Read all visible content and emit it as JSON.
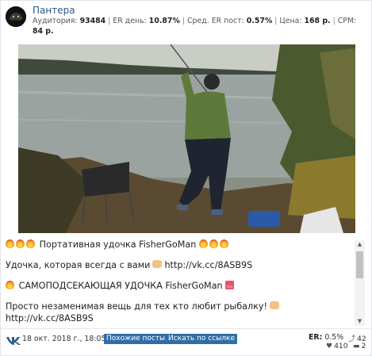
{
  "channel": {
    "name": "Пантера",
    "audience_label": "Аудитория:",
    "audience": "93484",
    "er_day_label": "ER день:",
    "er_day": "10.87%",
    "er_avg_label": "Сред. ER пост:",
    "er_avg": "0.57%",
    "price_label": "Цена:",
    "price": "168 р.",
    "cpm_label": "CPM:",
    "cpm": "84 р."
  },
  "post": {
    "line1": "Портативная удочка FisherGoMan",
    "line2": "Удочка, которая всегда с вами",
    "link1": "http://vk.cc/8ASB9S",
    "line3": "САМОПОДСЕКАЮЩАЯ УДОЧКА FisherGoMan",
    "line4": "Просто незаменимая вещь для тех кто любит рыбалку!",
    "link2": "http://vk.cc/8ASB9S"
  },
  "footer": {
    "date": "18 окт. 2018 г., 18:05",
    "similar_button": "Похожие посты",
    "search_button": "Искать по ссылке",
    "er_label": "ER:",
    "er_value": "0.5%",
    "reposts": "42",
    "likes": "410",
    "comments": "2"
  },
  "icons": [
    "panther-avatar",
    "flame-emoji",
    "pointing-hand-emoji",
    "gift-emoji",
    "vk-logo-icon",
    "repost-icon",
    "heart-icon",
    "comment-icon"
  ],
  "colors": {
    "link": "#2a5885",
    "button": "#2f6fa7"
  }
}
